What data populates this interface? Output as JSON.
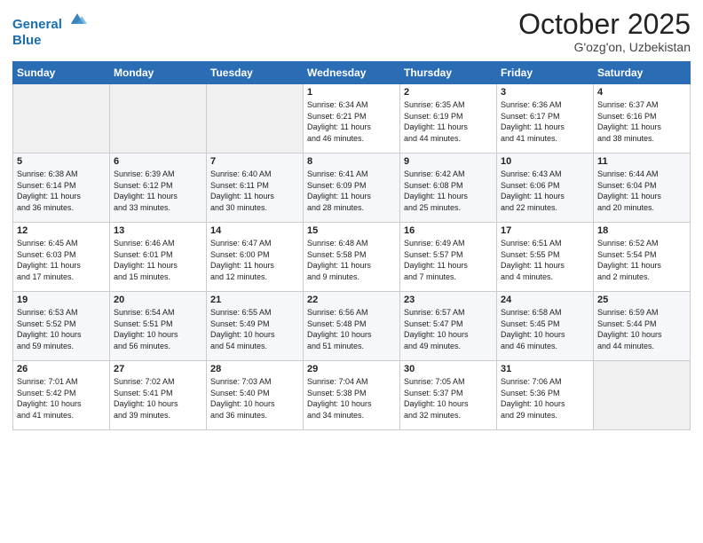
{
  "header": {
    "logo_line1": "General",
    "logo_line2": "Blue",
    "month": "October 2025",
    "location": "G'ozg'on, Uzbekistan"
  },
  "days_of_week": [
    "Sunday",
    "Monday",
    "Tuesday",
    "Wednesday",
    "Thursday",
    "Friday",
    "Saturday"
  ],
  "weeks": [
    [
      {
        "day": "",
        "info": ""
      },
      {
        "day": "",
        "info": ""
      },
      {
        "day": "",
        "info": ""
      },
      {
        "day": "1",
        "info": "Sunrise: 6:34 AM\nSunset: 6:21 PM\nDaylight: 11 hours\nand 46 minutes."
      },
      {
        "day": "2",
        "info": "Sunrise: 6:35 AM\nSunset: 6:19 PM\nDaylight: 11 hours\nand 44 minutes."
      },
      {
        "day": "3",
        "info": "Sunrise: 6:36 AM\nSunset: 6:17 PM\nDaylight: 11 hours\nand 41 minutes."
      },
      {
        "day": "4",
        "info": "Sunrise: 6:37 AM\nSunset: 6:16 PM\nDaylight: 11 hours\nand 38 minutes."
      }
    ],
    [
      {
        "day": "5",
        "info": "Sunrise: 6:38 AM\nSunset: 6:14 PM\nDaylight: 11 hours\nand 36 minutes."
      },
      {
        "day": "6",
        "info": "Sunrise: 6:39 AM\nSunset: 6:12 PM\nDaylight: 11 hours\nand 33 minutes."
      },
      {
        "day": "7",
        "info": "Sunrise: 6:40 AM\nSunset: 6:11 PM\nDaylight: 11 hours\nand 30 minutes."
      },
      {
        "day": "8",
        "info": "Sunrise: 6:41 AM\nSunset: 6:09 PM\nDaylight: 11 hours\nand 28 minutes."
      },
      {
        "day": "9",
        "info": "Sunrise: 6:42 AM\nSunset: 6:08 PM\nDaylight: 11 hours\nand 25 minutes."
      },
      {
        "day": "10",
        "info": "Sunrise: 6:43 AM\nSunset: 6:06 PM\nDaylight: 11 hours\nand 22 minutes."
      },
      {
        "day": "11",
        "info": "Sunrise: 6:44 AM\nSunset: 6:04 PM\nDaylight: 11 hours\nand 20 minutes."
      }
    ],
    [
      {
        "day": "12",
        "info": "Sunrise: 6:45 AM\nSunset: 6:03 PM\nDaylight: 11 hours\nand 17 minutes."
      },
      {
        "day": "13",
        "info": "Sunrise: 6:46 AM\nSunset: 6:01 PM\nDaylight: 11 hours\nand 15 minutes."
      },
      {
        "day": "14",
        "info": "Sunrise: 6:47 AM\nSunset: 6:00 PM\nDaylight: 11 hours\nand 12 minutes."
      },
      {
        "day": "15",
        "info": "Sunrise: 6:48 AM\nSunset: 5:58 PM\nDaylight: 11 hours\nand 9 minutes."
      },
      {
        "day": "16",
        "info": "Sunrise: 6:49 AM\nSunset: 5:57 PM\nDaylight: 11 hours\nand 7 minutes."
      },
      {
        "day": "17",
        "info": "Sunrise: 6:51 AM\nSunset: 5:55 PM\nDaylight: 11 hours\nand 4 minutes."
      },
      {
        "day": "18",
        "info": "Sunrise: 6:52 AM\nSunset: 5:54 PM\nDaylight: 11 hours\nand 2 minutes."
      }
    ],
    [
      {
        "day": "19",
        "info": "Sunrise: 6:53 AM\nSunset: 5:52 PM\nDaylight: 10 hours\nand 59 minutes."
      },
      {
        "day": "20",
        "info": "Sunrise: 6:54 AM\nSunset: 5:51 PM\nDaylight: 10 hours\nand 56 minutes."
      },
      {
        "day": "21",
        "info": "Sunrise: 6:55 AM\nSunset: 5:49 PM\nDaylight: 10 hours\nand 54 minutes."
      },
      {
        "day": "22",
        "info": "Sunrise: 6:56 AM\nSunset: 5:48 PM\nDaylight: 10 hours\nand 51 minutes."
      },
      {
        "day": "23",
        "info": "Sunrise: 6:57 AM\nSunset: 5:47 PM\nDaylight: 10 hours\nand 49 minutes."
      },
      {
        "day": "24",
        "info": "Sunrise: 6:58 AM\nSunset: 5:45 PM\nDaylight: 10 hours\nand 46 minutes."
      },
      {
        "day": "25",
        "info": "Sunrise: 6:59 AM\nSunset: 5:44 PM\nDaylight: 10 hours\nand 44 minutes."
      }
    ],
    [
      {
        "day": "26",
        "info": "Sunrise: 7:01 AM\nSunset: 5:42 PM\nDaylight: 10 hours\nand 41 minutes."
      },
      {
        "day": "27",
        "info": "Sunrise: 7:02 AM\nSunset: 5:41 PM\nDaylight: 10 hours\nand 39 minutes."
      },
      {
        "day": "28",
        "info": "Sunrise: 7:03 AM\nSunset: 5:40 PM\nDaylight: 10 hours\nand 36 minutes."
      },
      {
        "day": "29",
        "info": "Sunrise: 7:04 AM\nSunset: 5:38 PM\nDaylight: 10 hours\nand 34 minutes."
      },
      {
        "day": "30",
        "info": "Sunrise: 7:05 AM\nSunset: 5:37 PM\nDaylight: 10 hours\nand 32 minutes."
      },
      {
        "day": "31",
        "info": "Sunrise: 7:06 AM\nSunset: 5:36 PM\nDaylight: 10 hours\nand 29 minutes."
      },
      {
        "day": "",
        "info": ""
      }
    ]
  ]
}
